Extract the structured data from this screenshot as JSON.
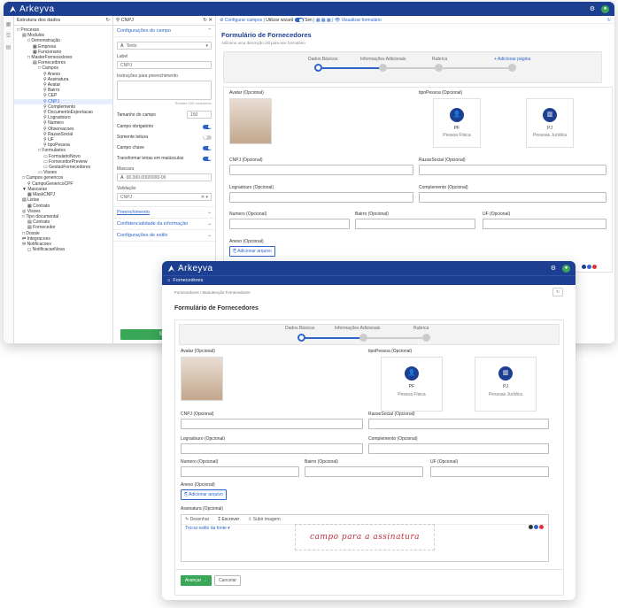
{
  "app": {
    "name": "Arkeyva"
  },
  "colors": {
    "brand": "#1d3f92",
    "accent": "#2f65c9",
    "success": "#3aa657"
  },
  "w1": {
    "tree_title": "Estrutura dos dados",
    "tree": [
      "Processo",
      "Modulos",
      "Demonstração",
      "Empresa",
      "Funcionario",
      "MasterFornecedores",
      "Fornecedores",
      "Campos",
      "Anexo",
      "Assinatura",
      "Avatar",
      "Bairro",
      "CEP",
      "CNPJ",
      "Complemento",
      "DocumentoExportacao",
      "Logradouro",
      "Numero",
      "Observacoes",
      "RazaoSocial",
      "UF",
      "tipoPessoa",
      "Formularios",
      "FormularioNovo",
      "FornecedorPreview",
      "GestaoFornecedores",
      "Visoes",
      "Campos genericos",
      "CampoGenericoCPF",
      "Mascaras",
      "MaskCNPJ",
      "Listas",
      "Contrato",
      "Visoes",
      "Tipo documental",
      "Contrato",
      "Fornecedor",
      "Dossie",
      "Integracoes",
      "Notificacoes",
      "NotificacaoNova"
    ],
    "mid_title": "CNPJ",
    "mid": {
      "config": "Configurações do campo",
      "type": "Texto",
      "label_l": "Label",
      "label_v": "CNPJ",
      "instr": "Instruções para preenchimento",
      "remain": "Restam 150 caracteres",
      "size_l": "Tamanho do campo",
      "size_v": "150",
      "t1": "Campo obrigatório",
      "t2": "Somente leitura",
      "t3": "Campo chave",
      "t4": "Transformar letras em maiúsculas",
      "mask_l": "Mascara",
      "mask_v": "00.000.000/0000-00",
      "valid_l": "Validação",
      "valid_v": "CNPJ",
      "s1": "Preenchimento",
      "s2": "Confidencialidade da informação",
      "s3": "Configurações de estilo",
      "save": "Salvar"
    },
    "topbar": {
      "cfg": "Configurar campos",
      "wiz": "Utilizar wizard",
      "sim": "Sim",
      "vis": "Visualizar formulário"
    },
    "form_title": "Formulário de Fornecedores",
    "form_sub": "Adicione uma descrição útil para seu formulário",
    "steps": [
      "Dados Básicos",
      "Informações Adicionais",
      "Rubrica",
      "+ Adicionar página"
    ],
    "fields": {
      "avatar": "Avatar (Opcional)",
      "tipo": "tipoPessoa (Opcional)",
      "pf": "PF",
      "pfl": "Pessoa Física",
      "pj": "PJ",
      "pjl": "Pessoas Jurídica",
      "cnpj": "CNPJ (Opcional)",
      "razao": "RazaoSocial (Opcional)",
      "logr": "Logradouro (Opcional)",
      "compl": "Complemento (Opcional)",
      "num": "Numero (Opcional)",
      "bairro": "Bairro (Opcional)",
      "uf": "UF (Opcional)",
      "anexo": "Anexo (Opcional)",
      "add": "Adicionar arquivo"
    }
  },
  "w2": {
    "menu": "Fornecedores",
    "crumb1": "Fornecedores",
    "crumb2": "Manutenção Fornecedores",
    "title": "Formulário de Fornecedores",
    "steps": [
      "Dados Básicos",
      "Informações Adicionais",
      "Rubrica"
    ],
    "fields": {
      "avatar": "Avatar (Opcional)",
      "tipo": "tipoPessoa (Opcional)",
      "pf": "PF",
      "pfl": "Pessoa Física",
      "pj": "PJ",
      "pjl": "Pessoas Jurídica",
      "cnpj": "CNPJ (Opcional)",
      "razao": "RazaoSocial (Opcional)",
      "logr": "Logradouro (Opcional)",
      "compl": "Complemento (Opcional)",
      "num": "Numero (Opcional)",
      "bairro": "Bairro (Opcional)",
      "uf": "UF (Opcional)",
      "anexo": "Anexo (Opcional)",
      "add": "Adicionar arquivo",
      "assin": "Assinatura (Opcional)"
    },
    "sigtabs": [
      "Desenhar",
      "Escrever",
      "Subir imagem"
    ],
    "fontsel": "Trocar estilo da fonte",
    "signature": "campo para a assinatura",
    "next": "Avançar",
    "cancel": "Cancelar"
  }
}
